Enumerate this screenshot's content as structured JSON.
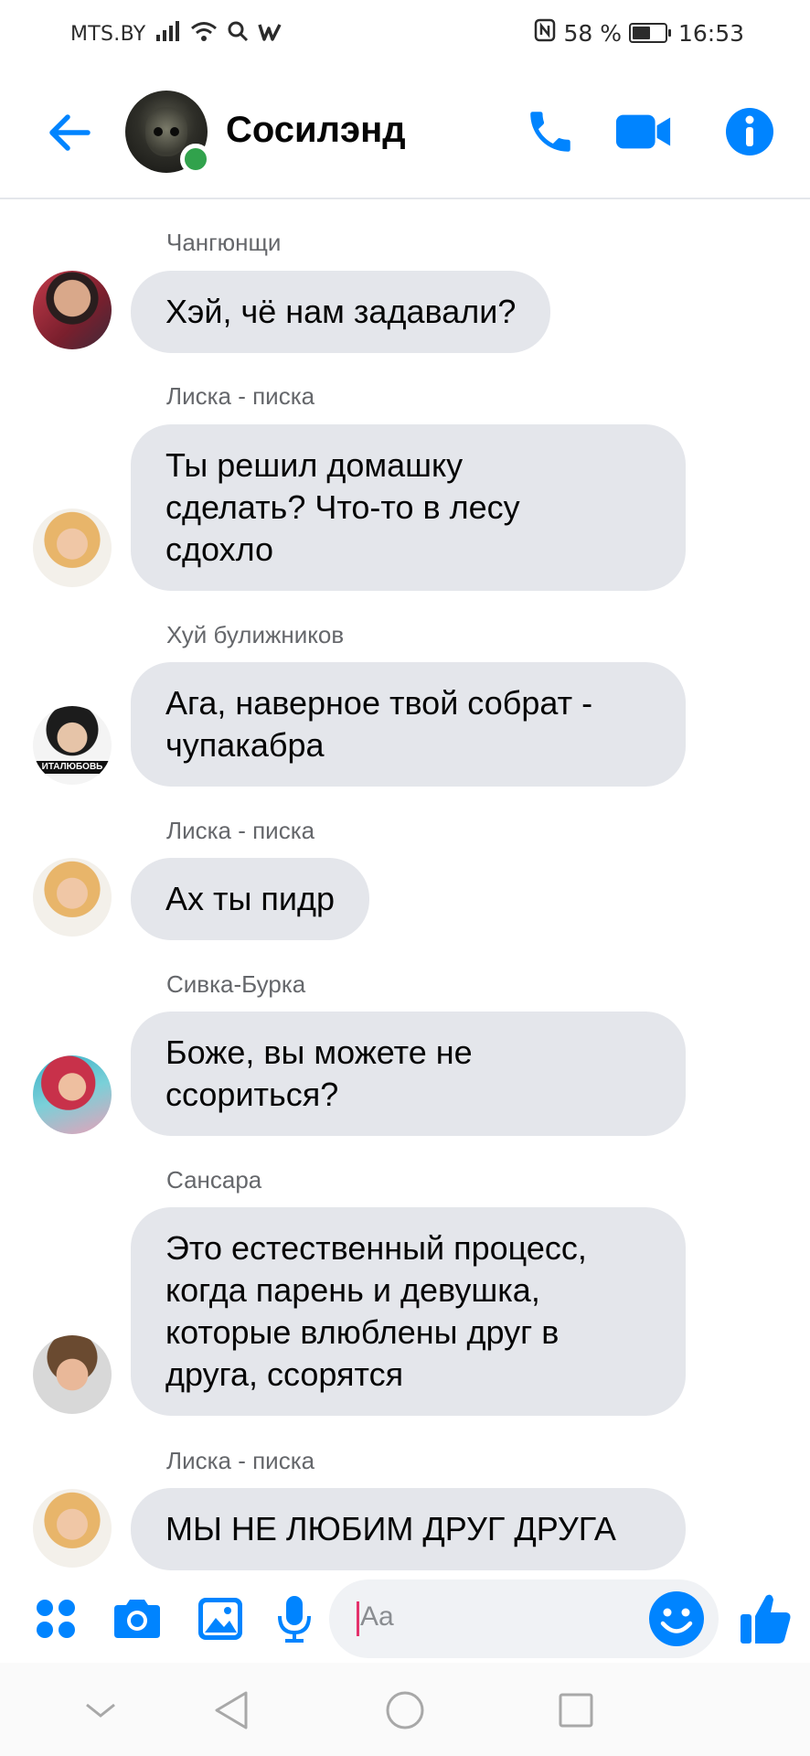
{
  "status_bar": {
    "carrier": "MTS.BY",
    "battery": "58 %",
    "battery_level": 0.58,
    "time": "16:53"
  },
  "header": {
    "title": "Сосилэнд",
    "online": true,
    "icons": [
      "back-arrow-icon",
      "phone-icon",
      "video-camera-icon",
      "info-icon"
    ]
  },
  "messages": [
    {
      "sender": "Чангюнщи",
      "lines": [
        "Хэй, чё нам задавали?"
      ]
    },
    {
      "sender": "Лиска - писка",
      "lines": [
        "Ты решил домашку",
        "сделать? Что-то в лесу",
        "сдохло"
      ]
    },
    {
      "sender": "Хуй булижников",
      "lines": [
        "Ага, наверное твой собрат -",
        "чупакабра"
      ],
      "avatar_caption": "ИТАЛЮБОВЬ"
    },
    {
      "sender": "Лиска - писка",
      "lines": [
        "Ах ты пидр"
      ]
    },
    {
      "sender": "Сивка-Бурка",
      "lines": [
        "Боже, вы можете не",
        "ссориться?"
      ]
    },
    {
      "sender": "Сансара",
      "lines": [
        "Это естественный процесс,",
        "когда парень и девушка,",
        "которые влюблены друг в",
        "друга, ссорятся"
      ]
    },
    {
      "sender": "Лиска - писка",
      "lines": [
        "МЫ НЕ ЛЮБИМ ДРУГ ДРУГА"
      ]
    }
  ],
  "composer": {
    "placeholder": "Aa",
    "icons": [
      "apps-grid-icon",
      "camera-icon",
      "gallery-icon",
      "microphone-icon",
      "emoji-icon",
      "thumbs-up-icon"
    ]
  },
  "colors": {
    "accent": "#0084ff",
    "bubble": "#e4e6eb",
    "sender_text": "#65676b",
    "online": "#31a24c"
  }
}
